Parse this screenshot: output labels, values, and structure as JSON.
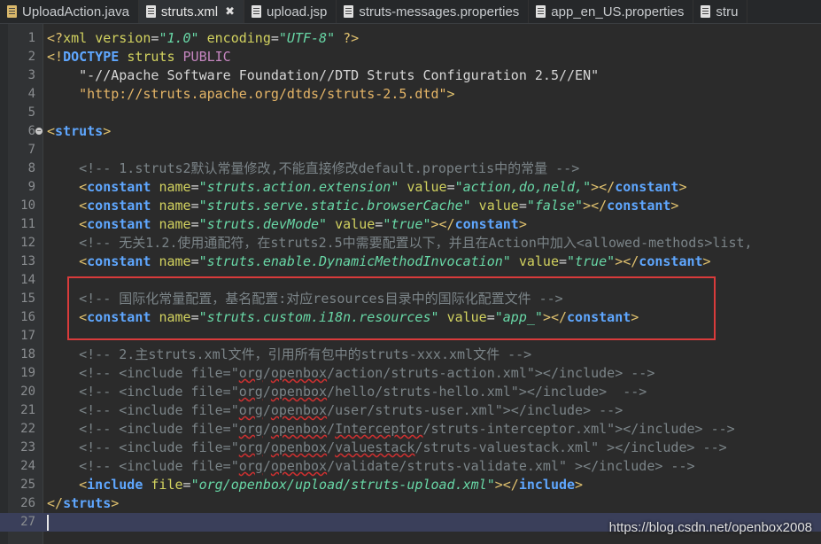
{
  "tabs": [
    {
      "label": "UploadAction.java",
      "icon": "java-file-icon",
      "active": false
    },
    {
      "label": "struts.xml",
      "icon": "xml-file-icon",
      "active": true,
      "close": "✖"
    },
    {
      "label": "upload.jsp",
      "icon": "jsp-file-icon",
      "active": false
    },
    {
      "label": "struts-messages.properties",
      "icon": "properties-file-icon",
      "active": false
    },
    {
      "label": "app_en_US.properties",
      "icon": "properties-file-icon",
      "active": false
    },
    {
      "label": "stru",
      "icon": "xml-file-icon",
      "active": false
    }
  ],
  "lines": [
    {
      "n": "1",
      "html": "<span class=\"t-punc\">&lt;?</span><span class=\"t-attr\">xml</span> <span class=\"t-attr\">version</span><span class=\"t-plain\">=</span><span class=\"t-val\">\"1.0\"</span> <span class=\"t-attr\">encoding</span><span class=\"t-plain\">=</span><span class=\"t-val\">\"UTF-8\"</span> <span class=\"t-punc\">?&gt;</span>"
    },
    {
      "n": "2",
      "html": "<span class=\"t-punc\">&lt;!</span><span class=\"t-tag\">DOCTYPE</span> <span class=\"t-attr\">struts</span> <span class=\"t-dt\">PUBLIC</span>"
    },
    {
      "n": "3",
      "html": "    <span class=\"t-str\">\"-//Apache Software Foundation//DTD Struts Configuration 2.5//EN\"</span>"
    },
    {
      "n": "4",
      "html": "    <span class=\"t-ent\">\"http://struts.apache.org/dtds/struts-2.5.dtd\"</span><span class=\"t-punc\">&gt;</span>"
    },
    {
      "n": "5",
      "html": ""
    },
    {
      "n": "6",
      "fold": true,
      "html": "<span class=\"t-punc\">&lt;</span><span class=\"t-tag\">struts</span><span class=\"t-punc\">&gt;</span>"
    },
    {
      "n": "7",
      "html": ""
    },
    {
      "n": "8",
      "html": "    <span class=\"t-cmt\">&lt;!-- 1.struts2默认常量修改,不能直接修改default.propertis中的常量 --&gt;</span>"
    },
    {
      "n": "9",
      "html": "    <span class=\"t-punc\">&lt;</span><span class=\"t-tag\">constant</span> <span class=\"t-attr\">name</span><span class=\"t-plain\">=</span><span class=\"t-val\">\"struts.action.extension\"</span> <span class=\"t-attr\">value</span><span class=\"t-plain\">=</span><span class=\"t-val\">\"action,do,neld,\"</span><span class=\"t-punc\">&gt;&lt;/</span><span class=\"t-tag\">constant</span><span class=\"t-punc\">&gt;</span>"
    },
    {
      "n": "10",
      "html": "    <span class=\"t-punc\">&lt;</span><span class=\"t-tag\">constant</span> <span class=\"t-attr\">name</span><span class=\"t-plain\">=</span><span class=\"t-val\">\"struts.serve.static.browserCache\"</span> <span class=\"t-attr\">value</span><span class=\"t-plain\">=</span><span class=\"t-val\">\"false\"</span><span class=\"t-punc\">&gt;&lt;/</span><span class=\"t-tag\">constant</span><span class=\"t-punc\">&gt;</span>"
    },
    {
      "n": "11",
      "html": "    <span class=\"t-punc\">&lt;</span><span class=\"t-tag\">constant</span> <span class=\"t-attr\">name</span><span class=\"t-plain\">=</span><span class=\"t-val\">\"struts.devMode\"</span> <span class=\"t-attr\">value</span><span class=\"t-plain\">=</span><span class=\"t-val\">\"true\"</span><span class=\"t-punc\">&gt;&lt;/</span><span class=\"t-tag\">constant</span><span class=\"t-punc\">&gt;</span>"
    },
    {
      "n": "12",
      "html": "    <span class=\"t-cmt\">&lt;!-- 无关1.2.使用通配符，在struts2.5中需要配置以下，并且在Action中加入&lt;allowed-methods&gt;list,</span>"
    },
    {
      "n": "13",
      "html": "    <span class=\"t-punc\">&lt;</span><span class=\"t-tag\">constant</span> <span class=\"t-attr\">name</span><span class=\"t-plain\">=</span><span class=\"t-val\">\"struts.enable.DynamicMethodInvocation\"</span> <span class=\"t-attr\">value</span><span class=\"t-plain\">=</span><span class=\"t-val\">\"true\"</span><span class=\"t-punc\">&gt;&lt;/</span><span class=\"t-tag\">constant</span><span class=\"t-punc\">&gt;</span>"
    },
    {
      "n": "14",
      "html": ""
    },
    {
      "n": "15",
      "html": "    <span class=\"t-cmt\">&lt;!-- 国际化常量配置，基名配置:对应resources目录中的国际化配置文件 --&gt;</span>"
    },
    {
      "n": "16",
      "html": "    <span class=\"t-punc\">&lt;</span><span class=\"t-tag\">constant</span> <span class=\"t-attr\">name</span><span class=\"t-plain\">=</span><span class=\"t-val\">\"struts.custom.i18n.resources\"</span> <span class=\"t-attr\">value</span><span class=\"t-plain\">=</span><span class=\"t-val\">\"app_\"</span><span class=\"t-punc\">&gt;&lt;/</span><span class=\"t-tag\">constant</span><span class=\"t-punc\">&gt;</span>"
    },
    {
      "n": "17",
      "html": ""
    },
    {
      "n": "18",
      "html": "    <span class=\"t-cmt\">&lt;!-- 2.主struts.xml文件，引用所有包中的struts-xxx.xml文件 --&gt;</span>"
    },
    {
      "n": "19",
      "html": "    <span class=\"t-cmt\">&lt;!-- &lt;include file=\"<span class=\"sq\">org</span>/<span class=\"sq\">openbox</span>/action/struts-action.xml\"&gt;&lt;/include&gt; --&gt;</span>"
    },
    {
      "n": "20",
      "html": "    <span class=\"t-cmt\">&lt;!-- &lt;include file=\"<span class=\"sq\">org</span>/<span class=\"sq\">openbox</span>/hello/struts-hello.xml\"&gt;&lt;/include&gt;  --&gt;</span>"
    },
    {
      "n": "21",
      "html": "    <span class=\"t-cmt\">&lt;!-- &lt;include file=\"<span class=\"sq\">org</span>/<span class=\"sq\">openbox</span>/user/struts-user.xml\"&gt;&lt;/include&gt; --&gt;</span>"
    },
    {
      "n": "22",
      "html": "    <span class=\"t-cmt\">&lt;!-- &lt;include file=\"<span class=\"sq\">org</span>/<span class=\"sq\">openbox</span>/<span class=\"sq\">Interceptor</span>/struts-interceptor.xml\"&gt;&lt;/include&gt; --&gt;</span>"
    },
    {
      "n": "23",
      "html": "    <span class=\"t-cmt\">&lt;!-- &lt;include file=\"<span class=\"sq\">org</span>/<span class=\"sq\">openbox</span>/<span class=\"sq\">valuestack</span>/struts-valuestack.xml\" &gt;&lt;/include&gt; --&gt;</span>"
    },
    {
      "n": "24",
      "html": "    <span class=\"t-cmt\">&lt;!-- &lt;include file=\"<span class=\"sq\">org</span>/<span class=\"sq\">openbox</span>/validate/struts-validate.xml\" &gt;&lt;/include&gt; --&gt;</span>"
    },
    {
      "n": "25",
      "html": "    <span class=\"t-punc\">&lt;</span><span class=\"t-tag\">include</span> <span class=\"t-attr\">file</span><span class=\"t-plain\">=</span><span class=\"t-val\">\"org/openbox/upload/struts-upload.xml\"</span><span class=\"t-punc\">&gt;&lt;/</span><span class=\"t-tag\">include</span><span class=\"t-punc\">&gt;</span>"
    },
    {
      "n": "26",
      "html": "<span class=\"t-punc\">&lt;/</span><span class=\"t-tag\">struts</span><span class=\"t-punc\">&gt;</span>"
    },
    {
      "n": "27",
      "cursor": true,
      "html": ""
    }
  ],
  "watermark": "https://blog.csdn.net/openbox2008"
}
